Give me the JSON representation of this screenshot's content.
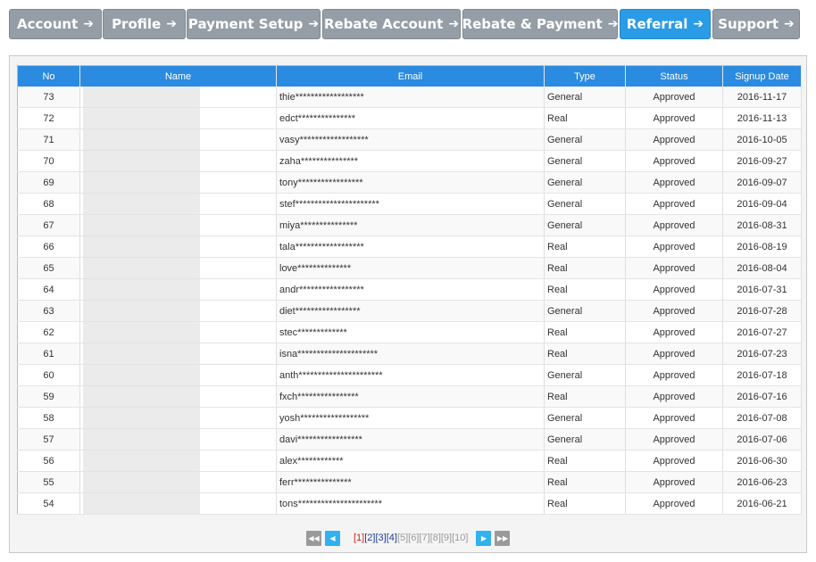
{
  "nav": {
    "tabs": [
      {
        "label": "Account",
        "active": false
      },
      {
        "label": "Profile",
        "active": false
      },
      {
        "label": "Payment Setup",
        "active": false
      },
      {
        "label": "Rebate Account",
        "active": false
      },
      {
        "label": "Rebate & Payment",
        "active": false
      },
      {
        "label": "Referral",
        "active": true
      },
      {
        "label": "Support",
        "active": false
      }
    ],
    "arrow_glyph": "➔"
  },
  "table": {
    "headers": {
      "no": "No",
      "name": "Name",
      "email": "Email",
      "type": "Type",
      "status": "Status",
      "date": "Signup Date"
    },
    "rows": [
      {
        "no": "73",
        "name": "",
        "email": "thie******************",
        "type": "General",
        "status": "Approved",
        "date": "2016-11-17"
      },
      {
        "no": "72",
        "name": "",
        "email": "edct***************",
        "type": "Real",
        "status": "Approved",
        "date": "2016-11-13"
      },
      {
        "no": "71",
        "name": "",
        "email": "vasy******************",
        "type": "General",
        "status": "Approved",
        "date": "2016-10-05"
      },
      {
        "no": "70",
        "name": "",
        "email": "zaha***************",
        "type": "General",
        "status": "Approved",
        "date": "2016-09-27"
      },
      {
        "no": "69",
        "name": "",
        "email": "tony*****************",
        "type": "General",
        "status": "Approved",
        "date": "2016-09-07"
      },
      {
        "no": "68",
        "name": "",
        "email": "stef**********************",
        "type": "General",
        "status": "Approved",
        "date": "2016-09-04"
      },
      {
        "no": "67",
        "name": "",
        "email": "miya***************",
        "type": "General",
        "status": "Approved",
        "date": "2016-08-31"
      },
      {
        "no": "66",
        "name": "",
        "email": "tala******************",
        "type": "Real",
        "status": "Approved",
        "date": "2016-08-19"
      },
      {
        "no": "65",
        "name": "",
        "email": "love**************",
        "type": "Real",
        "status": "Approved",
        "date": "2016-08-04"
      },
      {
        "no": "64",
        "name": "",
        "email": "andr*****************",
        "type": "Real",
        "status": "Approved",
        "date": "2016-07-31"
      },
      {
        "no": "63",
        "name": "",
        "email": "diet*****************",
        "type": "General",
        "status": "Approved",
        "date": "2016-07-28"
      },
      {
        "no": "62",
        "name": "",
        "email": "stec*************",
        "type": "Real",
        "status": "Approved",
        "date": "2016-07-27"
      },
      {
        "no": "61",
        "name": "",
        "email": "isna*********************",
        "type": "Real",
        "status": "Approved",
        "date": "2016-07-23"
      },
      {
        "no": "60",
        "name": "",
        "email": "anth**********************",
        "type": "General",
        "status": "Approved",
        "date": "2016-07-18"
      },
      {
        "no": "59",
        "name": "",
        "email": "fxch****************",
        "type": "Real",
        "status": "Approved",
        "date": "2016-07-16"
      },
      {
        "no": "58",
        "name": "",
        "email": "yosh******************",
        "type": "General",
        "status": "Approved",
        "date": "2016-07-08"
      },
      {
        "no": "57",
        "name": "",
        "email": "davi*****************",
        "type": "General",
        "status": "Approved",
        "date": "2016-07-06"
      },
      {
        "no": "56",
        "name": "",
        "email": "alex************",
        "type": "Real",
        "status": "Approved",
        "date": "2016-06-30"
      },
      {
        "no": "55",
        "name": "",
        "email": "ferr***************",
        "type": "Real",
        "status": "Approved",
        "date": "2016-06-23"
      },
      {
        "no": "54",
        "name": "",
        "email": "tons**********************",
        "type": "Real",
        "status": "Approved",
        "date": "2016-06-21"
      }
    ]
  },
  "pagination": {
    "first_icon": "first-page-icon",
    "prev_icon": "prev-page-icon",
    "next_icon": "next-page-icon",
    "last_icon": "last-page-icon",
    "first_glyph": "◀◀",
    "prev_glyph": "◀",
    "next_glyph": "▶",
    "last_glyph": "▶▶",
    "pages": [
      {
        "label": "[1]",
        "state": "current"
      },
      {
        "label": "[2]",
        "state": "link"
      },
      {
        "label": "[3]",
        "state": "link"
      },
      {
        "label": "[4]",
        "state": "link"
      },
      {
        "label": "[5]",
        "state": "dim"
      },
      {
        "label": "[6]",
        "state": "dim"
      },
      {
        "label": "[7]",
        "state": "dim"
      },
      {
        "label": "[8]",
        "state": "dim"
      },
      {
        "label": "[9]",
        "state": "dim"
      },
      {
        "label": "[10]",
        "state": "dim"
      }
    ]
  },
  "colors": {
    "accent": "#2a9be6",
    "header": "#2a8be0",
    "tab": "#959ea7",
    "current_page": "#d0241c"
  }
}
